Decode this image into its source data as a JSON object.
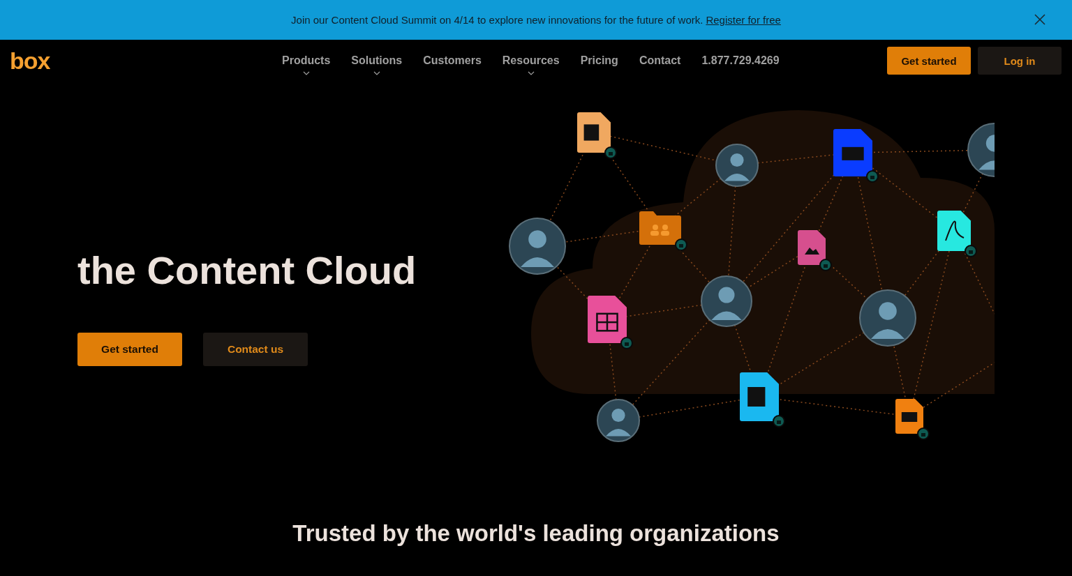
{
  "banner": {
    "text": "Join our Content Cloud Summit on 4/14 to explore new innovations for the future of work.",
    "link": "Register for free"
  },
  "nav": {
    "logo": "box",
    "items": [
      {
        "label": "Products",
        "has_menu": true
      },
      {
        "label": "Solutions",
        "has_menu": true
      },
      {
        "label": "Customers",
        "has_menu": false
      },
      {
        "label": "Resources",
        "has_menu": true
      },
      {
        "label": "Pricing",
        "has_menu": false
      },
      {
        "label": "Contact",
        "has_menu": false
      },
      {
        "label": "1.877.729.4269",
        "has_menu": false
      }
    ],
    "buttons": [
      {
        "label": "Get started",
        "kind": "primary"
      },
      {
        "label": "Log in",
        "kind": "secondary"
      }
    ]
  },
  "hero": {
    "heading": "the Content Cloud",
    "buttons": [
      {
        "label": "Get started",
        "kind": "primary"
      },
      {
        "label": "Contact us",
        "kind": "secondary"
      }
    ]
  },
  "trusted": {
    "heading": "Trusted by the world's leading organizations"
  }
}
